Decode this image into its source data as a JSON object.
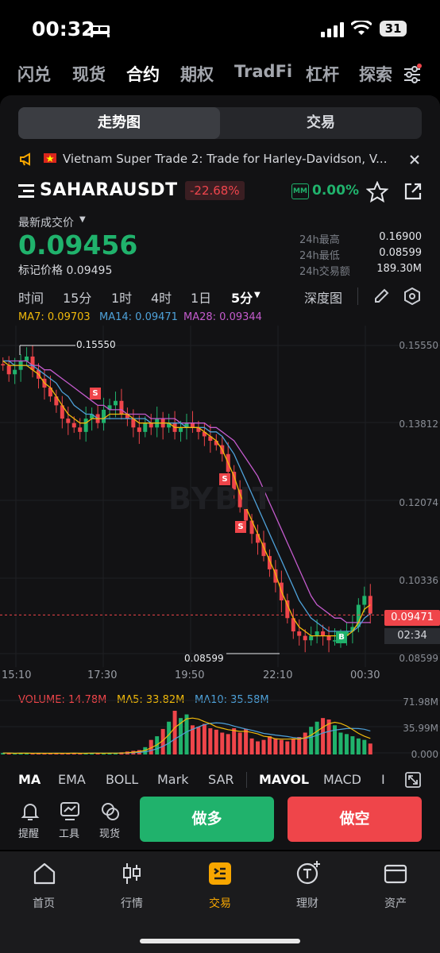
{
  "status_bar": {
    "time": "00:32",
    "battery": "31"
  },
  "top_nav": [
    "闪兑",
    "现货",
    "合约",
    "期权",
    "TradFi",
    "杠杆",
    "探索"
  ],
  "top_nav_active": "合约",
  "segment": {
    "chart": "走势图",
    "trade": "交易"
  },
  "announcement": "Vietnam Super Trade 2: Trade for Harley-Davidson, V...",
  "symbol": {
    "name": "SAHARAUSDT",
    "change": "-22.68%",
    "mm_badge": "MM",
    "mm_value": "0.00%"
  },
  "price": {
    "last_label": "最新成交价",
    "last": "0.09456",
    "mark_label": "标记价格",
    "mark": "0.09495",
    "high_label": "24h最高",
    "high": "0.16900",
    "low_label": "24h最低",
    "low": "0.08599",
    "vol_label": "24h交易额",
    "vol": "189.30M"
  },
  "timeframes": [
    "时间",
    "15分",
    "1时",
    "4时",
    "1日",
    "5分"
  ],
  "timeframe_active": "5分",
  "depth_label": "深度图",
  "ma_labels": {
    "ma7": "MA7: 0.09703",
    "ma14": "MA14: 0.09471",
    "ma28": "MA28: 0.09344"
  },
  "watermark": "BYBIT",
  "chart_data": {
    "type": "candlestick",
    "y_ticks": [
      "0.15550",
      "0.13812",
      "0.12074",
      "0.10336",
      "0.08599"
    ],
    "ylim": [
      0.08599,
      0.1555
    ],
    "x_ticks": [
      "15:10",
      "17:30",
      "19:50",
      "22:10",
      "00:30"
    ],
    "current_price_tag": "0.09471",
    "countdown": "02:34",
    "high_marker": "0.15550",
    "low_marker": "0.08599",
    "trade_markers": [
      "S",
      "S",
      "S",
      "B"
    ],
    "close_series": [
      0.151,
      0.149,
      0.15,
      0.152,
      0.153,
      0.15,
      0.148,
      0.146,
      0.144,
      0.142,
      0.139,
      0.138,
      0.137,
      0.136,
      0.139,
      0.14,
      0.138,
      0.141,
      0.142,
      0.143,
      0.14,
      0.139,
      0.137,
      0.136,
      0.138,
      0.137,
      0.139,
      0.137,
      0.138,
      0.136,
      0.137,
      0.138,
      0.137,
      0.136,
      0.135,
      0.134,
      0.133,
      0.131,
      0.127,
      0.123,
      0.119,
      0.116,
      0.113,
      0.111,
      0.108,
      0.105,
      0.102,
      0.098,
      0.094,
      0.091,
      0.09,
      0.089,
      0.09,
      0.091,
      0.09,
      0.089,
      0.089,
      0.09,
      0.091,
      0.092,
      0.097,
      0.099,
      0.095
    ],
    "ma7": [
      0.152,
      0.151,
      0.151,
      0.151,
      0.151,
      0.15,
      0.149,
      0.147,
      0.146,
      0.144,
      0.142,
      0.14,
      0.139,
      0.138,
      0.138,
      0.139,
      0.139,
      0.139,
      0.14,
      0.14,
      0.14,
      0.14,
      0.139,
      0.138,
      0.138,
      0.138,
      0.138,
      0.138,
      0.138,
      0.137,
      0.137,
      0.137,
      0.137,
      0.137,
      0.136,
      0.135,
      0.134,
      0.132,
      0.129,
      0.126,
      0.122,
      0.119,
      0.116,
      0.113,
      0.11,
      0.107,
      0.104,
      0.1,
      0.097,
      0.094,
      0.092,
      0.091,
      0.09,
      0.09,
      0.09,
      0.09,
      0.09,
      0.09,
      0.09,
      0.091,
      0.093,
      0.096,
      0.097
    ],
    "ma14": [
      0.152,
      0.152,
      0.151,
      0.151,
      0.151,
      0.151,
      0.15,
      0.149,
      0.148,
      0.147,
      0.145,
      0.144,
      0.142,
      0.141,
      0.14,
      0.14,
      0.139,
      0.139,
      0.139,
      0.139,
      0.139,
      0.139,
      0.139,
      0.139,
      0.139,
      0.138,
      0.138,
      0.138,
      0.138,
      0.138,
      0.138,
      0.137,
      0.137,
      0.137,
      0.137,
      0.136,
      0.136,
      0.135,
      0.133,
      0.131,
      0.128,
      0.125,
      0.122,
      0.119,
      0.116,
      0.113,
      0.11,
      0.107,
      0.104,
      0.101,
      0.098,
      0.096,
      0.094,
      0.093,
      0.092,
      0.091,
      0.091,
      0.091,
      0.091,
      0.091,
      0.092,
      0.094,
      0.095
    ],
    "ma28": [
      0.152,
      0.152,
      0.152,
      0.152,
      0.152,
      0.151,
      0.151,
      0.15,
      0.15,
      0.149,
      0.148,
      0.147,
      0.146,
      0.145,
      0.144,
      0.143,
      0.142,
      0.142,
      0.141,
      0.141,
      0.141,
      0.14,
      0.14,
      0.14,
      0.14,
      0.139,
      0.139,
      0.139,
      0.139,
      0.139,
      0.138,
      0.138,
      0.138,
      0.138,
      0.138,
      0.137,
      0.137,
      0.136,
      0.135,
      0.134,
      0.132,
      0.13,
      0.128,
      0.126,
      0.123,
      0.12,
      0.117,
      0.114,
      0.111,
      0.108,
      0.105,
      0.102,
      0.099,
      0.097,
      0.096,
      0.095,
      0.094,
      0.094,
      0.093,
      0.093,
      0.093,
      0.093,
      0.093
    ],
    "volume": {
      "label": "VOLUME: 14.78M",
      "ma5": "MA5: 33.82M",
      "ma10": "MA10: 35.58M",
      "y_ticks": [
        "71.98M",
        "35.99M",
        "0.000"
      ],
      "ylim": [
        0,
        71.98
      ],
      "values": [
        2,
        2,
        1,
        2,
        2,
        1,
        2,
        1,
        2,
        2,
        1,
        2,
        2,
        1,
        2,
        2,
        2,
        1,
        2,
        2,
        3,
        4,
        5,
        6,
        10,
        20,
        25,
        35,
        45,
        60,
        50,
        55,
        40,
        38,
        42,
        36,
        34,
        30,
        28,
        36,
        30,
        35,
        22,
        18,
        20,
        25,
        22,
        20,
        18,
        22,
        24,
        30,
        38,
        45,
        50,
        48,
        40,
        30,
        28,
        25,
        22,
        20,
        15
      ]
    },
    "colors": {
      "up": "#20b26c",
      "down": "#ef454a",
      "ma7": "#f0b90b",
      "ma14": "#4ea1d9",
      "ma28": "#c45bcd"
    }
  },
  "indicators": [
    "MA",
    "EMA",
    "BOLL",
    "Mark",
    "SAR",
    "MAVOL",
    "MACD",
    "I"
  ],
  "indicators_active": [
    "MA",
    "MAVOL"
  ],
  "tools": [
    "提醒",
    "工具",
    "现货"
  ],
  "actions": {
    "long": "做多",
    "short": "做空"
  },
  "tabs": [
    "首页",
    "行情",
    "交易",
    "理财",
    "资产"
  ],
  "tab_active": "交易"
}
